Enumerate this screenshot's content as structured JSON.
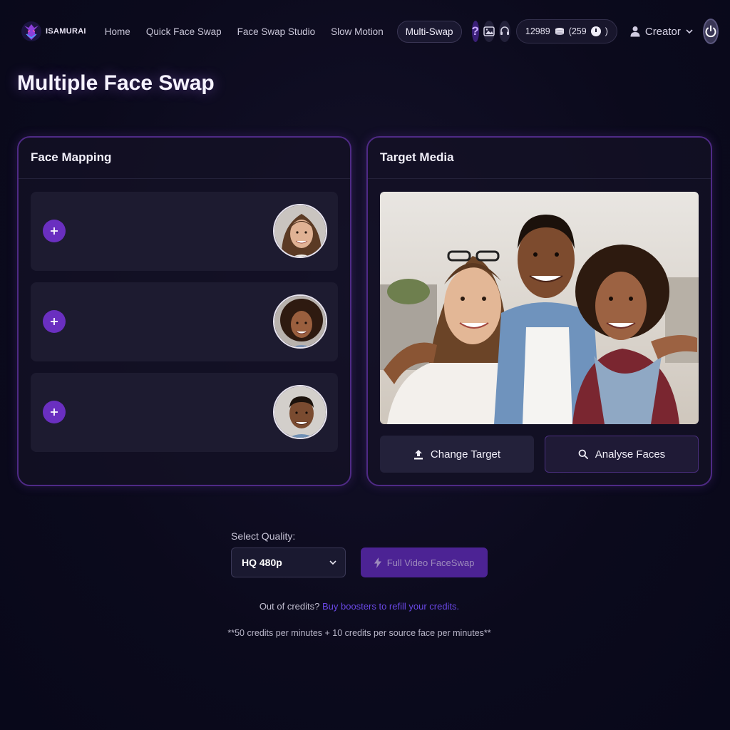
{
  "brand": {
    "name": "ISAMURAI"
  },
  "nav": {
    "links": [
      "Home",
      "Quick Face Swap",
      "Face Swap Studio",
      "Slow Motion",
      "Multi-Swap"
    ],
    "help_label": "?",
    "credits": "12989",
    "timer": "(259",
    "timer_close": ")",
    "user": "Creator"
  },
  "page": {
    "title": "Multiple Face Swap"
  },
  "face_mapping": {
    "title": "Face Mapping",
    "rows": [
      {
        "face": "woman-smiling-long-brown-hair"
      },
      {
        "face": "woman-curly-hair"
      },
      {
        "face": "man-short-hair"
      }
    ]
  },
  "target_media": {
    "title": "Target Media",
    "image": "group-photo-three-friends",
    "change_label": "Change Target",
    "analyse_label": "Analyse Faces"
  },
  "quality": {
    "label": "Select Quality:",
    "selected": "HQ 480p",
    "action_label": "Full Video FaceSwap"
  },
  "credits_note": {
    "prefix": "Out of credits?",
    "link": "Buy boosters to refill your credits."
  },
  "footnote": "**50 credits per minutes + 10 credits per source face per minutes**",
  "colors": {
    "accent": "#6a2fc0",
    "panel_border": "#4f2a86",
    "link": "#6a48e6"
  }
}
